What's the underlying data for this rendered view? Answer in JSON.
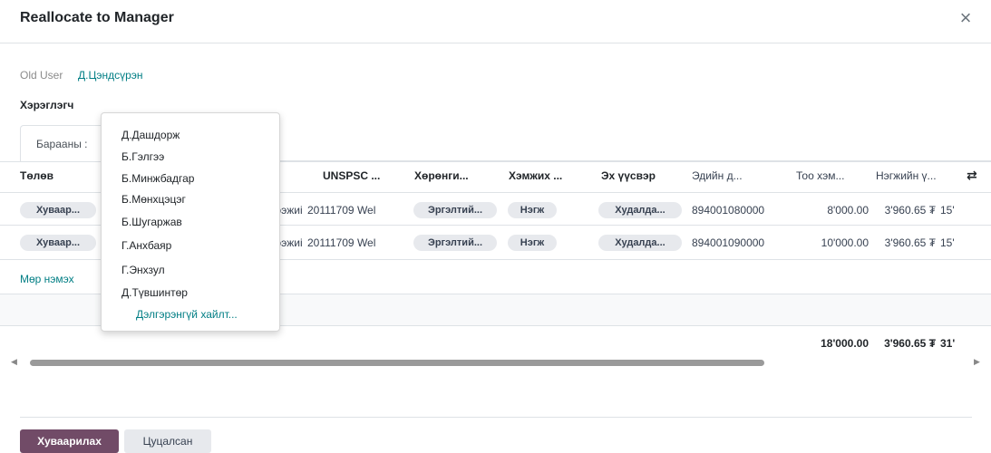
{
  "dialog": {
    "title": "Reallocate to Manager",
    "close_icon": "close-icon"
  },
  "form": {
    "old_user_label": "Old User",
    "old_user_value": "Д.Цэндсүрэн",
    "user_label": "Хэрэглэгч"
  },
  "tabs": [
    {
      "label": "Барааны :"
    }
  ],
  "table": {
    "headers": [
      "Төлөв",
      "UNSPSC ...",
      "Хөрөнги...",
      "Хэмжих ...",
      "Эх үүсвэр",
      "Эдийн д...",
      "Тоо хэм...",
      "Нэгжийн ү..."
    ],
    "settings_icon": "column-settings-icon",
    "rows": [
      {
        "status": "Хуваар...",
        "name_fragment": "ээжиі",
        "unspsc": "20111709 Wel",
        "asset": "Эргэлтий...",
        "unit": "Нэгж",
        "source": "Худалда...",
        "asset_code": "894001080000",
        "qty": "8'000.00",
        "price": "3'960.65 ₮",
        "extra": "15'"
      },
      {
        "status": "Хуваар...",
        "name_fragment": "ээжиі",
        "unspsc": "20111709 Wel",
        "asset": "Эргэлтий...",
        "unit": "Нэгж",
        "source": "Худалда...",
        "asset_code": "894001090000",
        "qty": "10'000.00",
        "price": "3'960.65 ₮",
        "extra": "15'"
      }
    ],
    "add_line": "Мөр нэмэх",
    "totals": {
      "qty": "18'000.00",
      "price": "3'960.65 ₮",
      "extra": "31'"
    }
  },
  "dropdown": {
    "items": [
      "Д.Дашдорж",
      "Б.Гэлгээ",
      "Б.Минжбадгар",
      "Б.Мөнхцэцэг",
      "Б.Шугаржав",
      "Г.Анхбаяр",
      "Г.Энхзул",
      "Д.Түвшинтөр"
    ],
    "search_more": "Дэлгэрэнгүй хайлт..."
  },
  "footer": {
    "primary_label": "Хуваарилах",
    "secondary_label": "Цуцалсан"
  },
  "colors": {
    "primary": "#714b67",
    "link": "#017e84"
  }
}
